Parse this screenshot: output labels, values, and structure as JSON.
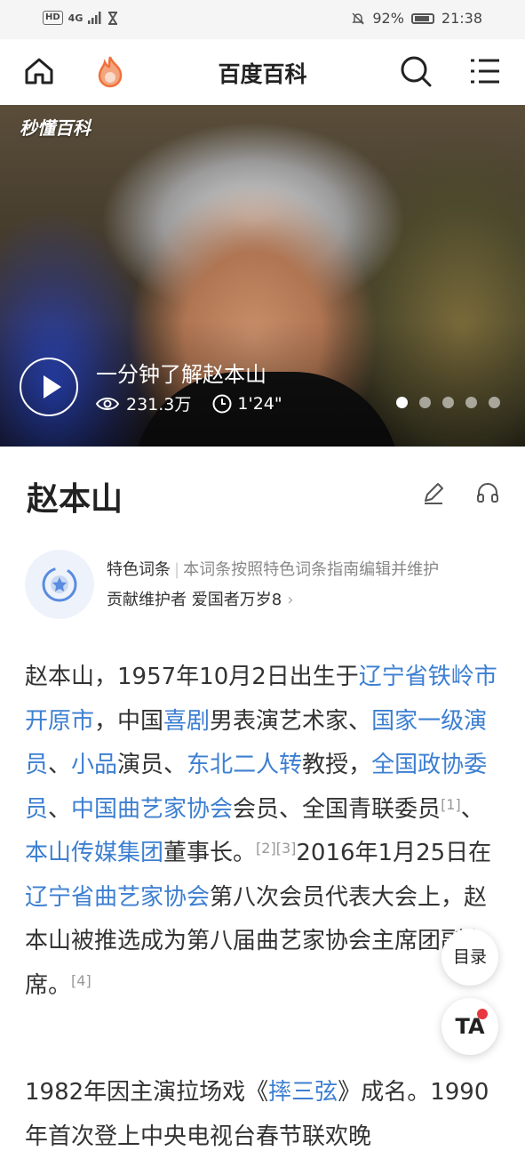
{
  "status_bar": {
    "network": "HD",
    "signal": "4G",
    "battery_percent": "92%",
    "time": "21:38"
  },
  "nav": {
    "title": "百度百科",
    "icons": [
      "home-icon",
      "flame-icon",
      "search-icon",
      "menu-icon"
    ]
  },
  "hero": {
    "logo": "秒懂百科",
    "video_title": "一分钟了解赵本山",
    "views": "231.3万",
    "duration": "1'24\"",
    "slide_count": 5,
    "active_slide": 1
  },
  "entry": {
    "title": "赵本山",
    "featured_label": "特色词条",
    "featured_desc": "本词条按照特色词条指南编辑并维护",
    "maintainer_label": "贡献维护者",
    "maintainer_name": "爱国者万岁8"
  },
  "article": {
    "p1": {
      "t1": "赵本山，1957年10月2日出生于",
      "l1": "辽宁省铁岭市开原市",
      "t2": "，中国",
      "l2": "喜剧",
      "t3": "男表演艺术家、",
      "l3": "国家一级演员",
      "t4": "、",
      "l4": "小品",
      "t5": "演员、",
      "l5": "东北二人转",
      "t6": "教授，",
      "l6": "全国政协委员",
      "t7": "、",
      "l7": "中国曲艺家协会",
      "t8": "会员、全国青联委员",
      "s1": "[1]",
      "t9": "、",
      "l8": "本山传媒集团",
      "t10": "董事长。",
      "s2": "[2][3]",
      "t11": "2016年1月25日在",
      "l9": "辽宁省曲艺家协会",
      "t12": "第八次会员代表大会上，赵本山被推选成为第八届曲艺家协会主席团副主席。",
      "s3": "[4]"
    },
    "p2": {
      "t1": "1982年因主演拉场戏《",
      "l1": "摔三弦",
      "t2": "》成名。1990年首次登上中央电视台春节联欢晚"
    }
  },
  "floating": {
    "toc_label": "目录",
    "ta_label": "TA"
  },
  "colors": {
    "link": "#3d7fd1",
    "accent_orange": "#f0703a",
    "notification_dot": "#e6383e"
  }
}
